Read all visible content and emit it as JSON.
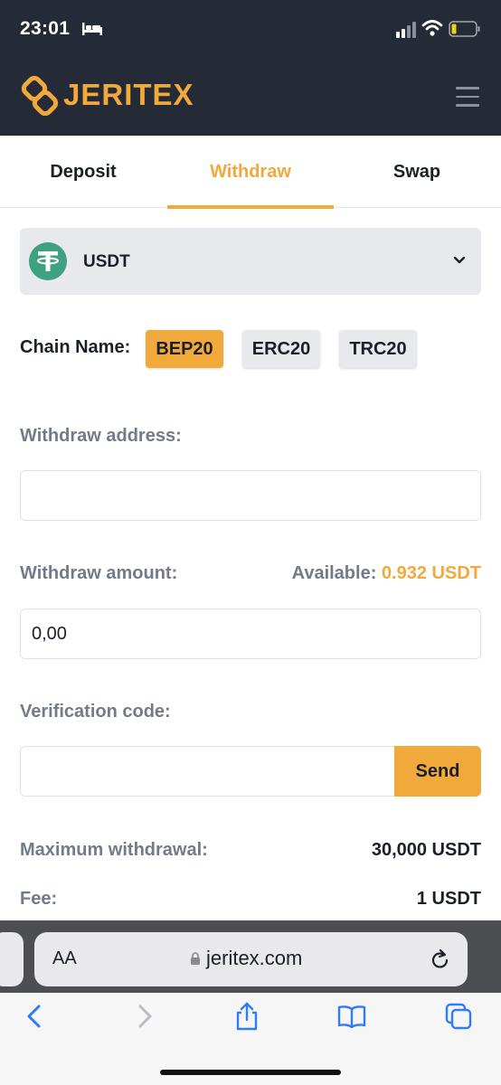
{
  "status_bar": {
    "time": "23:01"
  },
  "header": {
    "brand": "JERITEX"
  },
  "tabs": [
    {
      "label": "Deposit"
    },
    {
      "label": "Withdraw"
    },
    {
      "label": "Swap"
    }
  ],
  "coin": {
    "selected": "USDT"
  },
  "chain": {
    "label": "Chain Name:",
    "options": [
      "BEP20",
      "ERC20",
      "TRC20"
    ],
    "selected": "BEP20"
  },
  "form": {
    "address_label": "Withdraw address:",
    "address_value": "",
    "amount_label": "Withdraw amount:",
    "available_label": "Available:",
    "available_value": "0.932 USDT",
    "amount_value": "0,00",
    "code_label": "Verification code:",
    "code_value": "",
    "send_label": "Send"
  },
  "info": {
    "max_label": "Maximum withdrawal:",
    "max_value": "30,000 USDT",
    "fee_label": "Fee:",
    "fee_value": "1 USDT"
  },
  "browser": {
    "text_size": "AA",
    "url": "jeritex.com"
  },
  "colors": {
    "accent": "#f2a93b",
    "header_bg": "#242a36",
    "tether_green": "#3ea281"
  }
}
